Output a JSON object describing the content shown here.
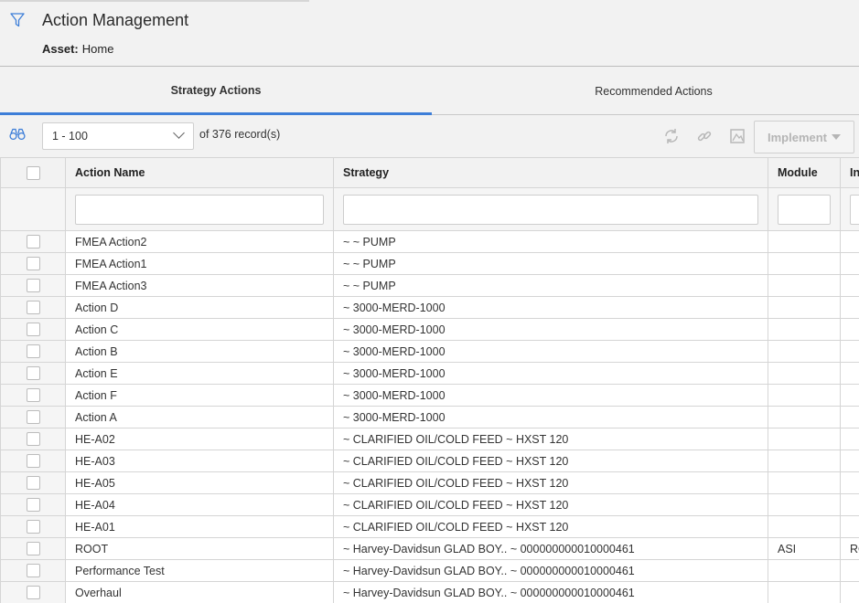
{
  "header": {
    "title": "Action Management",
    "asset_label": "Asset:",
    "asset_value": "Home"
  },
  "tabs": [
    {
      "label": "Strategy Actions",
      "active": true
    },
    {
      "label": "Recommended Actions",
      "active": false
    }
  ],
  "toolbar": {
    "page_range": "1 - 100",
    "records_text": "of 376 record(s)",
    "implement_label": "Implement"
  },
  "table": {
    "columns": [
      "Action Name",
      "Strategy",
      "Module",
      "In"
    ],
    "rows": [
      {
        "action_name": "FMEA Action2",
        "strategy": "~ ~ PUMP",
        "module": "",
        "extra": ""
      },
      {
        "action_name": "FMEA Action1",
        "strategy": "~ ~ PUMP",
        "module": "",
        "extra": ""
      },
      {
        "action_name": "FMEA Action3",
        "strategy": "~ ~ PUMP",
        "module": "",
        "extra": ""
      },
      {
        "action_name": "Action D",
        "strategy": "~ 3000-MERD-1000",
        "module": "",
        "extra": ""
      },
      {
        "action_name": "Action C",
        "strategy": "~ 3000-MERD-1000",
        "module": "",
        "extra": ""
      },
      {
        "action_name": "Action B",
        "strategy": "~ 3000-MERD-1000",
        "module": "",
        "extra": ""
      },
      {
        "action_name": "Action E",
        "strategy": "~ 3000-MERD-1000",
        "module": "",
        "extra": ""
      },
      {
        "action_name": "Action F",
        "strategy": "~ 3000-MERD-1000",
        "module": "",
        "extra": ""
      },
      {
        "action_name": "Action A",
        "strategy": "~ 3000-MERD-1000",
        "module": "",
        "extra": ""
      },
      {
        "action_name": "HE-A02",
        "strategy": "~ CLARIFIED OIL/COLD FEED ~ HXST 120",
        "module": "",
        "extra": ""
      },
      {
        "action_name": "HE-A03",
        "strategy": "~ CLARIFIED OIL/COLD FEED ~ HXST 120",
        "module": "",
        "extra": ""
      },
      {
        "action_name": "HE-A05",
        "strategy": "~ CLARIFIED OIL/COLD FEED ~ HXST 120",
        "module": "",
        "extra": ""
      },
      {
        "action_name": "HE-A04",
        "strategy": "~ CLARIFIED OIL/COLD FEED ~ HXST 120",
        "module": "",
        "extra": ""
      },
      {
        "action_name": "HE-A01",
        "strategy": "~ CLARIFIED OIL/COLD FEED ~ HXST 120",
        "module": "",
        "extra": ""
      },
      {
        "action_name": "ROOT",
        "strategy": "~ Harvey-Davidsun GLAD BOY.. ~ 000000000010000461",
        "module": "ASI",
        "extra": "RO"
      },
      {
        "action_name": "Performance Test",
        "strategy": "~ Harvey-Davidsun GLAD BOY.. ~ 000000000010000461",
        "module": "",
        "extra": ""
      },
      {
        "action_name": "Overhaul",
        "strategy": "~ Harvey-Davidsun GLAD BOY.. ~ 000000000010000461",
        "module": "",
        "extra": ""
      }
    ]
  },
  "colors": {
    "accent": "#3d7ed8",
    "link": "#3d7ed8",
    "disabled": "#b5b5b5"
  }
}
